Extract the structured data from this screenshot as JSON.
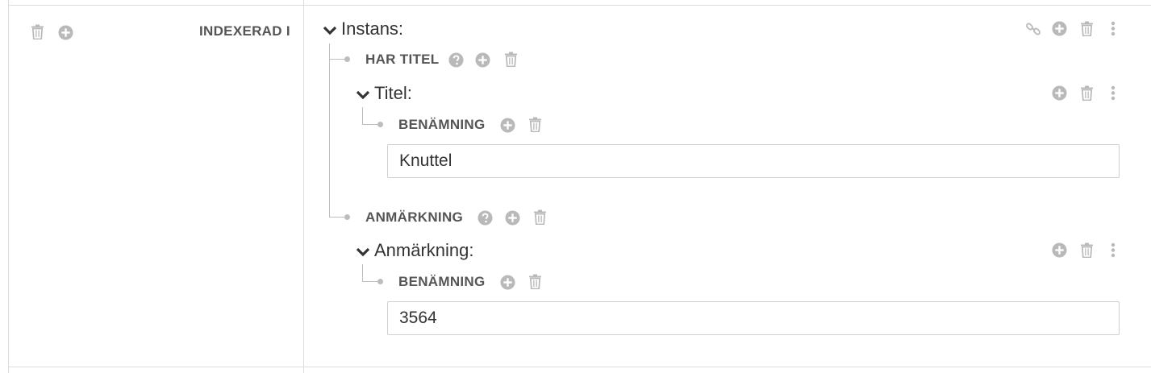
{
  "left_column": {
    "property_label": "INDEXERAD I",
    "actions": [
      "trash-icon",
      "add-icon"
    ]
  },
  "instance": {
    "title": "Instans:",
    "actions": [
      "link-icon",
      "add-icon",
      "trash-icon",
      "kebab-menu-icon"
    ],
    "properties": [
      {
        "label": "HAR TITEL",
        "actions": [
          "help-icon",
          "add-icon",
          "trash-icon"
        ],
        "entity": {
          "title": "Titel:",
          "actions": [
            "add-icon",
            "trash-icon",
            "kebab-menu-icon"
          ],
          "field_label": "BENÄMNING",
          "field_actions": [
            "add-icon",
            "trash-icon"
          ],
          "value": "Knuttel"
        }
      },
      {
        "label": "ANMÄRKNING",
        "actions": [
          "help-icon",
          "add-icon",
          "trash-icon"
        ],
        "entity": {
          "title": "Anmärkning:",
          "actions": [
            "add-icon",
            "trash-icon",
            "kebab-menu-icon"
          ],
          "field_label": "BENÄMNING",
          "field_actions": [
            "add-icon",
            "trash-icon"
          ],
          "value": "3564"
        }
      }
    ]
  },
  "colors": {
    "icon": "#b9b9b9",
    "border": "#dcdcdc",
    "text": "#333333",
    "label": "#555555"
  }
}
